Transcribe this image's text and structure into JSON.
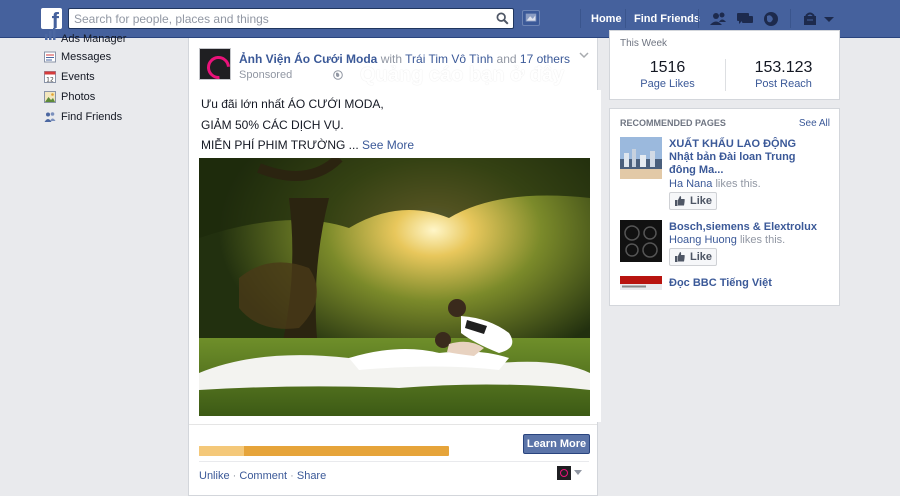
{
  "topbar": {
    "logo_letter": "f",
    "search_placeholder": "Search for people, places and things",
    "home": "Home",
    "find_friends": "Find Friends"
  },
  "left_nav": {
    "items": [
      {
        "label": "Ads Manager",
        "icon": "chart-icon"
      },
      {
        "label": "Messages",
        "icon": "messages-icon"
      },
      {
        "label": "Events",
        "icon": "calendar-icon"
      },
      {
        "label": "Photos",
        "icon": "photos-icon"
      },
      {
        "label": "Find Friends",
        "icon": "friends-icon"
      }
    ]
  },
  "story": {
    "page_name": "Ảnh Viện Áo Cưới Moda",
    "with_text": "with",
    "tagged": "Trái Tim Vô Tình",
    "and_text": "and",
    "others": "17 others",
    "sponsored": "Sponsored",
    "overlay": "Quảng cáo bạn ở đây",
    "lines": [
      "Ưu đãi lớn nhất ÁO CƯỚI MODA,",
      "GIẢM 50% CÁC DỊCH VỤ.",
      "MIỄN PHÍ PHIM TRƯỜNG ..."
    ],
    "see_more": "See More",
    "progress_fraction": 0.18,
    "learn_more": "Learn More",
    "unlike": "Unlike",
    "comment": "Comment",
    "share": "Share",
    "sep": "·"
  },
  "stats": {
    "title": "This Week",
    "page_likes_value": "1516",
    "page_likes_label": "Page Likes",
    "post_reach_value": "153.123",
    "post_reach_label": "Post Reach"
  },
  "recommended": {
    "title": "RECOMMENDED PAGES",
    "see_all": "See All",
    "items": [
      {
        "name": "XUẤT KHẨU LAO ĐỘNG Nhật bản Đài loan Trung đông Ma...",
        "liker": "Ha Nana",
        "likes_suffix": "likes this.",
        "button": "Like"
      },
      {
        "name": "Bosch,siemens & Elextrolux",
        "liker": "Hoang Huong",
        "likes_suffix": "likes this.",
        "button": "Like"
      },
      {
        "name": "Đọc BBC Tiếng Việt"
      }
    ]
  },
  "colors": {
    "brand": "#45619d",
    "link": "#3b5998",
    "page_bg": "#e9eaed",
    "progress_track": "#e6a43a",
    "progress_fill": "#f4c879"
  }
}
